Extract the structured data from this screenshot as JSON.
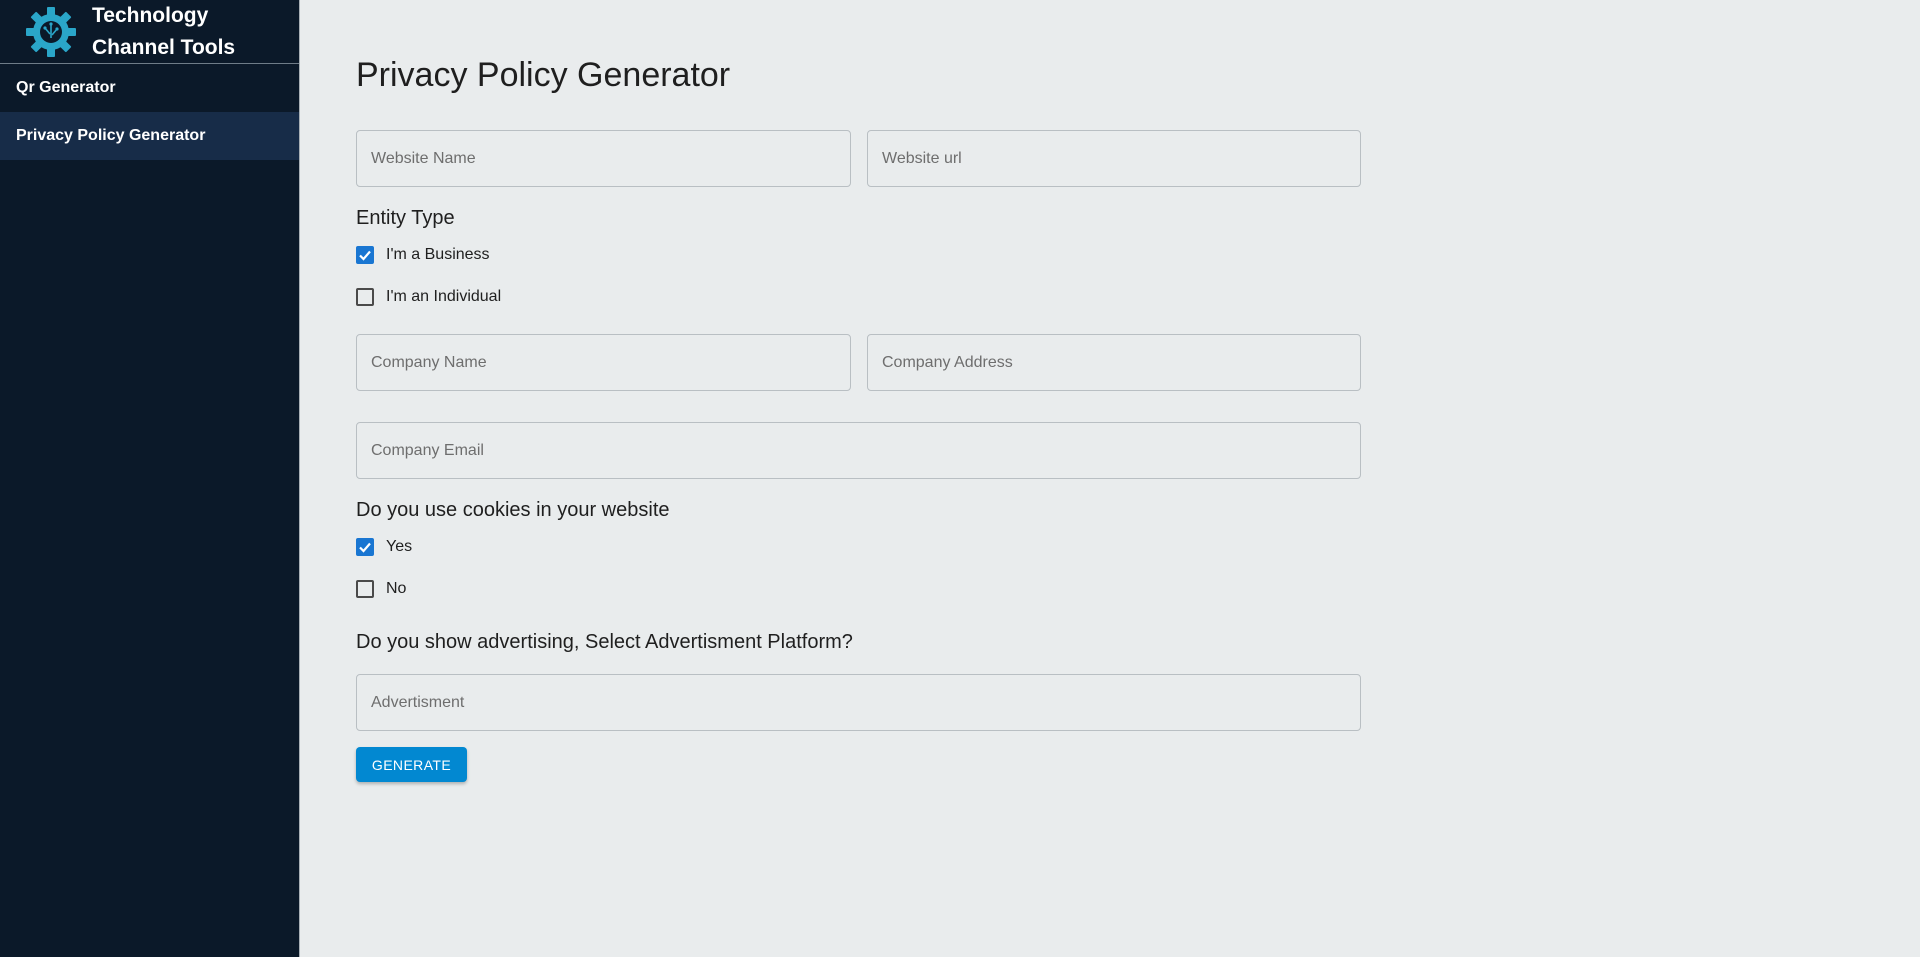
{
  "sidebar": {
    "brand_line1": "Technology",
    "brand_line2": "Channel Tools",
    "items": [
      {
        "label": "Qr Generator",
        "active": false
      },
      {
        "label": "Privacy Policy Generator",
        "active": true
      }
    ]
  },
  "main": {
    "title": "Privacy Policy Generator",
    "website_name": {
      "placeholder": "Website Name",
      "value": ""
    },
    "website_url": {
      "placeholder": "Website url",
      "value": ""
    },
    "entity_type": {
      "label": "Entity Type",
      "options": [
        {
          "label": "I'm a Business",
          "checked": true
        },
        {
          "label": "I'm an Individual",
          "checked": false
        }
      ]
    },
    "company_name": {
      "placeholder": "Company Name",
      "value": ""
    },
    "company_address": {
      "placeholder": "Company Address",
      "value": ""
    },
    "company_email": {
      "placeholder": "Company Email",
      "value": ""
    },
    "cookies": {
      "label": "Do you use cookies in your website",
      "options": [
        {
          "label": "Yes",
          "checked": true
        },
        {
          "label": "No",
          "checked": false
        }
      ]
    },
    "advertising": {
      "label": "Do you show advertising, Select Advertisment Platform?",
      "placeholder": "Advertisment",
      "value": ""
    },
    "generate_label": "GENERATE"
  },
  "colors": {
    "sidebar_bg": "#0b1929",
    "sidebar_active": "#172c48",
    "page_bg": "#e9eced",
    "checkbox_checked": "#1976d2",
    "button_bg": "#0288d1",
    "logo_accent": "#2aa6c9"
  },
  "icons": {
    "logo": "gear-logo-icon",
    "checkmark": "checkmark-icon"
  }
}
